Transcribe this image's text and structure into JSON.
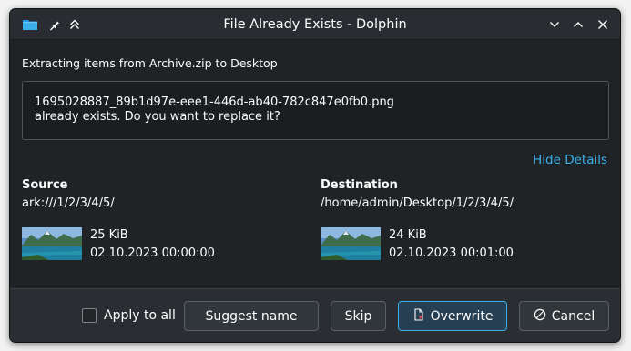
{
  "titlebar": {
    "title": "File Already Exists - Dolphin",
    "icons": [
      "folder-app-icon",
      "pin-icon",
      "keep-above-icon"
    ],
    "controls": [
      "minimize-icon",
      "maximize-icon",
      "close-icon"
    ]
  },
  "dialog": {
    "extracting_prefix": "Extracting items from Archive.zip to",
    "extracting_target": "Desktop",
    "message_line1": "1695028887_89b1d97e-eee1-446d-ab40-782c847e0fb0.png",
    "message_line2": "already exists. Do you want to replace it?",
    "hide_details": "Hide Details",
    "source": {
      "heading": "Source",
      "path": "ark:///1/2/3/4/5/",
      "size": "25 KiB",
      "date": "02.10.2023 00:00:00"
    },
    "destination": {
      "heading": "Destination",
      "path": "/home/admin/Desktop/1/2/3/4/5/",
      "size": "24 KiB",
      "date": "02.10.2023 00:01:00"
    }
  },
  "footer": {
    "apply_to_all_label": "Apply to all",
    "apply_to_all_checked": false,
    "suggest_name": "Suggest name",
    "skip": "Skip",
    "overwrite": "Overwrite",
    "cancel": "Cancel"
  },
  "colors": {
    "accent": "#3daee9",
    "window_bg": "#202326",
    "footer_bg": "#2a2e32"
  }
}
